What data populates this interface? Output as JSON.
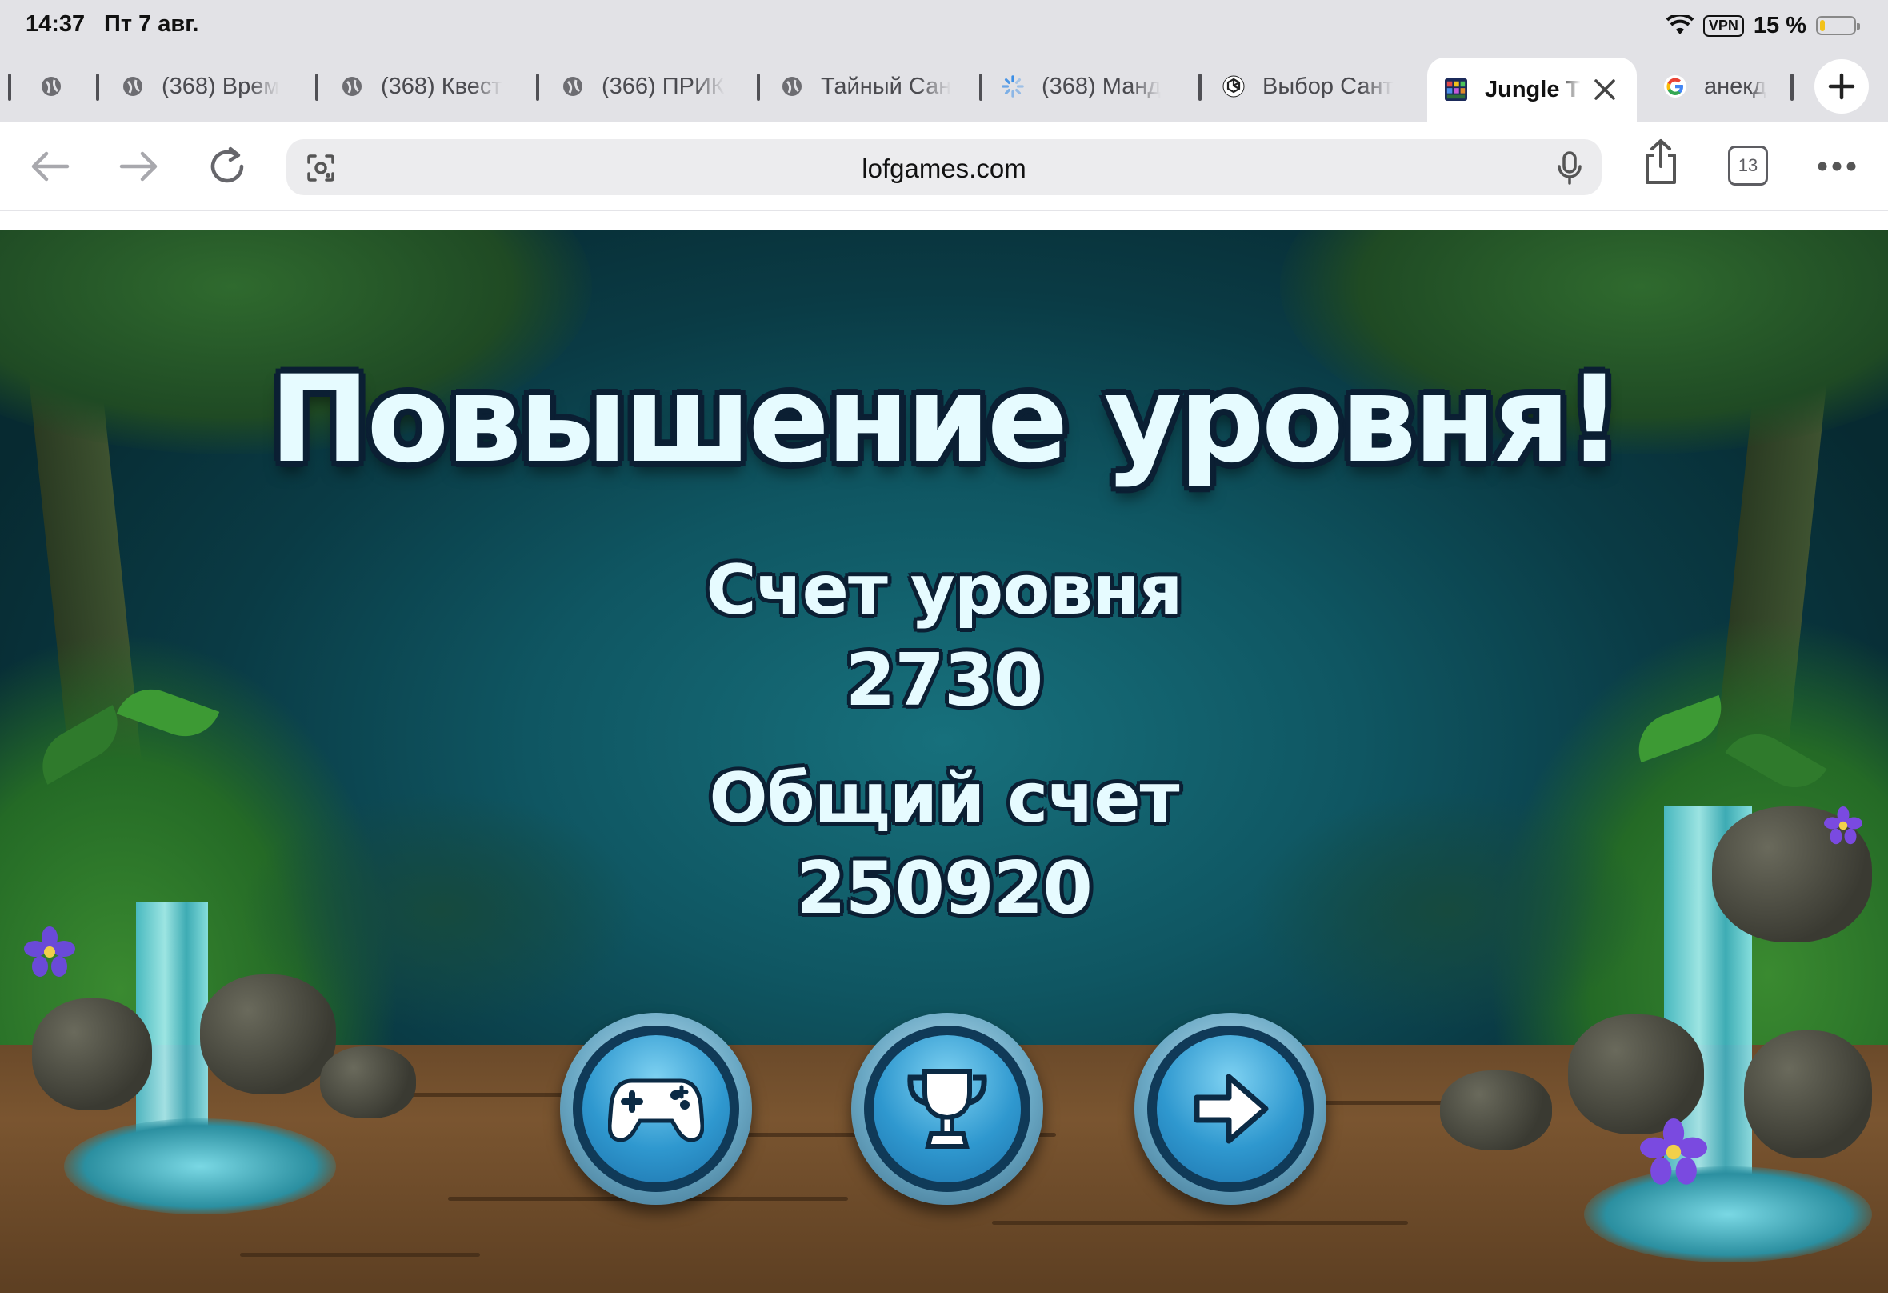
{
  "status_bar": {
    "time": "14:37",
    "date": "Пт 7 авг.",
    "vpn": "VPN",
    "battery": "15 %",
    "battery_level": 0.15
  },
  "tabs": [
    {
      "title": "(368) Врем",
      "favicon": "globe-icon"
    },
    {
      "title": "(368) Квест",
      "favicon": "globe-icon"
    },
    {
      "title": "(366) ПРИК",
      "favicon": "globe-icon"
    },
    {
      "title": "Тайный Сан",
      "favicon": "globe-icon"
    },
    {
      "title": "(368) Манд",
      "favicon": "loading-icon"
    },
    {
      "title": "Выбор Сант",
      "favicon": "openai-icon"
    },
    {
      "title": "Jungle T",
      "favicon": "game-icon",
      "active": true
    },
    {
      "title": "анекд",
      "favicon": "google-icon"
    }
  ],
  "toolbar": {
    "url": "lofgames.com",
    "tab_count": "13"
  },
  "game": {
    "title": "Повышение уровня!",
    "level_score_label": "Счет уровня",
    "level_score": "2730",
    "total_score_label": "Общий счет",
    "total_score": "250920",
    "buttons": [
      "gamepad-icon",
      "trophy-icon",
      "arrow-right-icon"
    ]
  },
  "colors": {
    "text": "#e6fbff",
    "outline": "#0b1f33",
    "button": "#2f98cf"
  }
}
